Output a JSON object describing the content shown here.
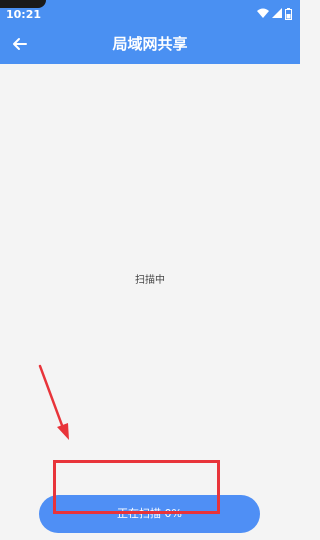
{
  "status_bar": {
    "time": "10:21",
    "icons": [
      "wifi-icon",
      "signal-icon",
      "battery-icon"
    ]
  },
  "app_bar": {
    "back_icon": "arrow-left-icon",
    "title": "局域网共享"
  },
  "content": {
    "scan_status": "扫描中"
  },
  "scan_button": {
    "label": "正在扫描 0%",
    "progress_percent": 0
  },
  "colors": {
    "primary": "#4a90f2",
    "button": "#4f8ff5",
    "background": "#f4f4f4",
    "annotation": "#e8343a"
  }
}
